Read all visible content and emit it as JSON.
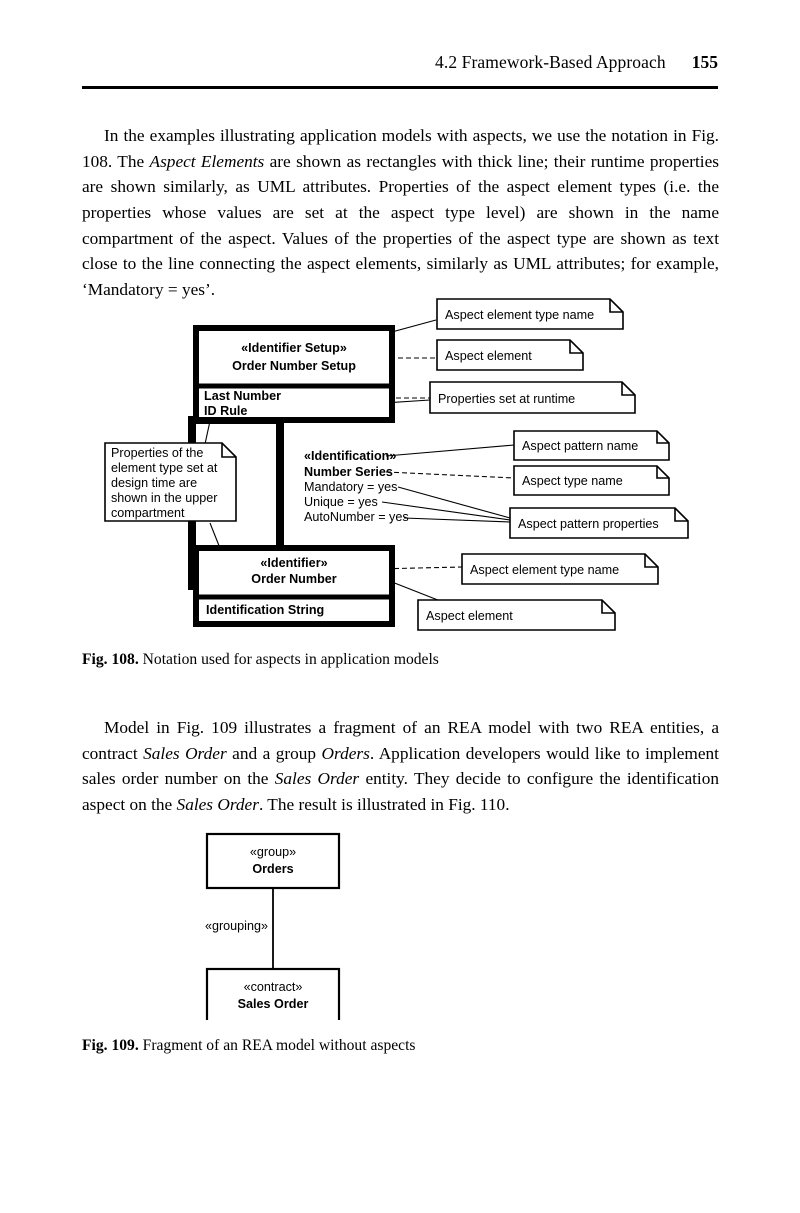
{
  "header": {
    "section": "4.2  Framework-Based Approach",
    "page_number": "155"
  },
  "paragraphs": {
    "p1_a": "In the examples illustrating application models with aspects, we use the notation in Fig. 108. The ",
    "p1_i1": "Aspect Elements",
    "p1_b": " are shown as rectangles with thick line; their runtime properties are shown similarly, as UML attributes. Properties of the aspect element types (i.e. the properties whose values are set at the aspect type level) are shown in the name compartment of the aspect. Values of the properties of the aspect type are shown as text close to the line connecting the aspect elements, similarly as UML attributes; for example, ‘Mandatory = yes’.",
    "p2_a": "Model in Fig. 109 illustrates a fragment of an REA model with two REA entities, a contract ",
    "p2_i1": "Sales Order",
    "p2_b": " and a group ",
    "p2_i2": "Orders",
    "p2_c": ". Application developers would like to implement sales order number on the ",
    "p2_i3": "Sales Order",
    "p2_d": " entity. They decide to configure the identification aspect on the ",
    "p2_i4": "Sales Order",
    "p2_e": ". The result is illustrated in Fig. 110."
  },
  "captions": {
    "fig108_label": "Fig. 108.",
    "fig108_text": " Notation used for aspects in application models",
    "fig109_label": "Fig. 109.",
    "fig109_text": " Fragment of an REA model without aspects"
  },
  "figure108": {
    "top_element": {
      "stereotype": "«Identifier Setup»",
      "name": "Order Number Setup",
      "attributes": [
        "Last Number",
        "ID Rule"
      ]
    },
    "bottom_element": {
      "stereotype": "«Identifier»",
      "name": "Order Number",
      "attributes": [
        "Identification String"
      ]
    },
    "aspect_pattern": {
      "pattern_name": "«Identification»",
      "type_name": "Number Series",
      "properties": [
        "Mandatory = yes",
        "Unique = yes",
        "AutoNumber = yes"
      ]
    },
    "notes": {
      "n1": "Aspect element type name",
      "n2": "Aspect element",
      "n3": "Properties set at runtime",
      "n4": "Aspect pattern name",
      "n5": "Aspect type name",
      "n6": "Aspect pattern properties",
      "n7": "Aspect element type name",
      "n8": "Aspect element",
      "n9_lines": [
        "Properties of the",
        "element type set at",
        "design time are",
        "shown in the upper",
        "compartment"
      ]
    }
  },
  "figure109": {
    "top_box": {
      "stereotype": "«group»",
      "name": "Orders"
    },
    "bottom_box": {
      "stereotype": "«contract»",
      "name": "Sales Order"
    },
    "association_label": "«grouping»"
  },
  "colors": {
    "ink": "#000000",
    "paper": "#ffffff"
  }
}
